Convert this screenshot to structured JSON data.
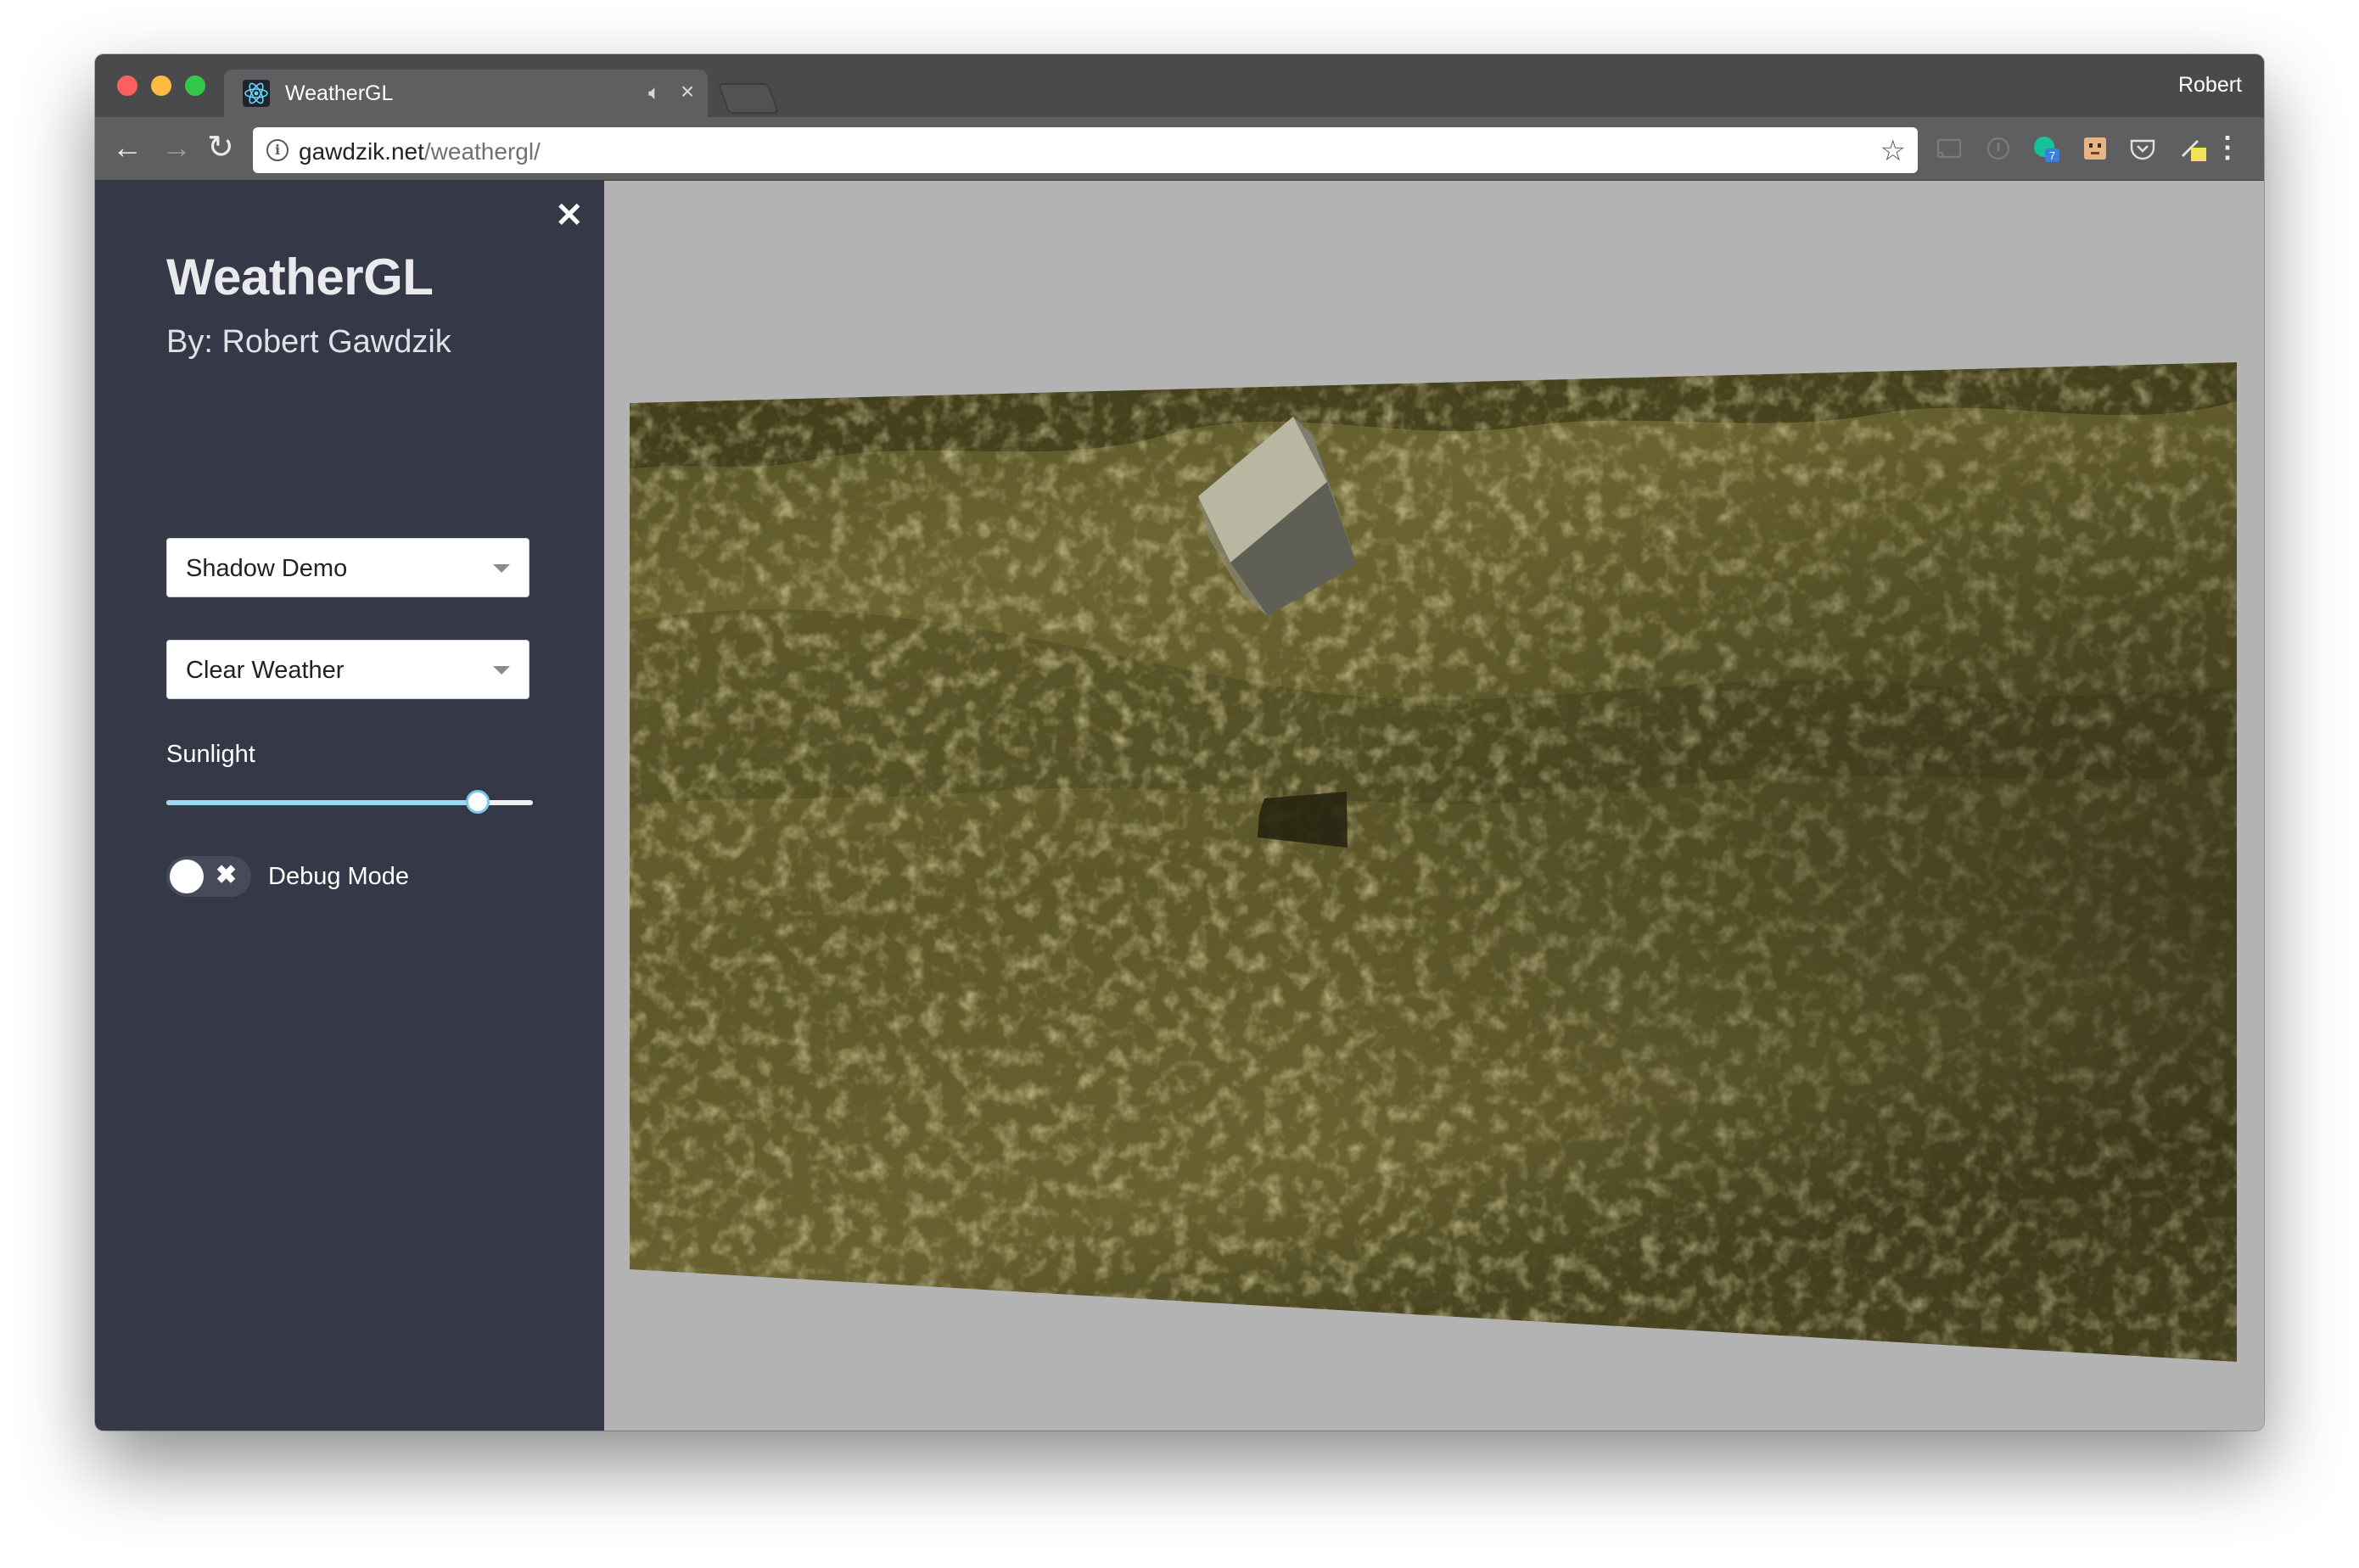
{
  "browser": {
    "tab_title": "WeatherGL",
    "profile_name": "Robert",
    "url_host": "gawdzik.net",
    "url_path": "/weathergl/",
    "extension_badge": "7"
  },
  "sidebar": {
    "title": "WeatherGL",
    "author": "By: Robert Gawdzik",
    "demo_select": {
      "value": "Shadow Demo"
    },
    "weather_select": {
      "value": "Clear Weather"
    },
    "sunlight": {
      "label": "Sunlight",
      "level": 0.85
    },
    "debug_toggle": {
      "label": "Debug Mode",
      "on": false
    }
  },
  "colors": {
    "sidebar_bg": "#353847",
    "viewport_bg": "#b3b3b3",
    "slider_fill": "#9fd8f2",
    "terrain": "#6b6431"
  },
  "icons": [
    "react-icon",
    "audio-icon",
    "close-icon",
    "back-arrow-icon",
    "forward-arrow-icon",
    "reload-icon",
    "info-icon",
    "star-icon",
    "cast-icon",
    "menu-dots-icon"
  ]
}
